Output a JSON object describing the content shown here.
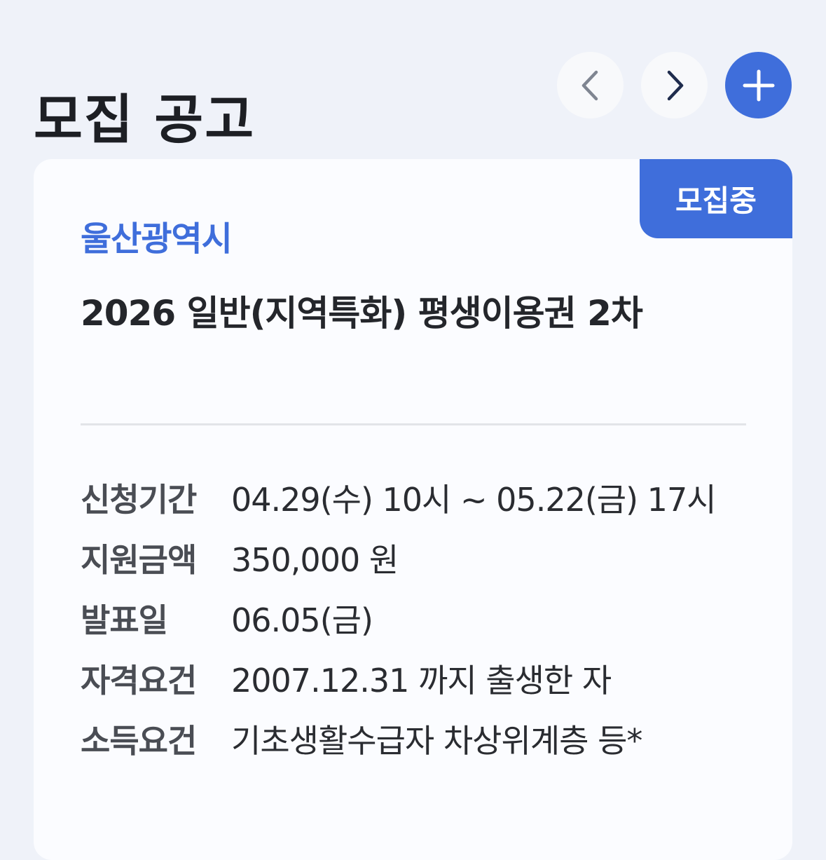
{
  "header": {
    "title": "모집 공고",
    "prev_icon": "chevron-left-icon",
    "next_icon": "chevron-right-icon",
    "add_icon": "plus-icon"
  },
  "card": {
    "status_badge": "모집중",
    "region": "울산광역시",
    "title": "2026 일반(지역특화) 평생이용권 2차",
    "info": [
      {
        "label": "신청기간",
        "value": "04.29(수) 10시 ~ 05.22(금) 17시"
      },
      {
        "label": "지원금액",
        "value": "350,000 원"
      },
      {
        "label": "발표일",
        "value": "06.05(금)"
      },
      {
        "label": "자격요건",
        "value": "2007.12.31 까지 출생한 자"
      },
      {
        "label": "소득요건",
        "value": "기초생활수급자 차상위계층 등*"
      }
    ]
  },
  "colors": {
    "accent": "#3f6edb",
    "background": "#eff2f9",
    "card": "#fbfcff"
  }
}
